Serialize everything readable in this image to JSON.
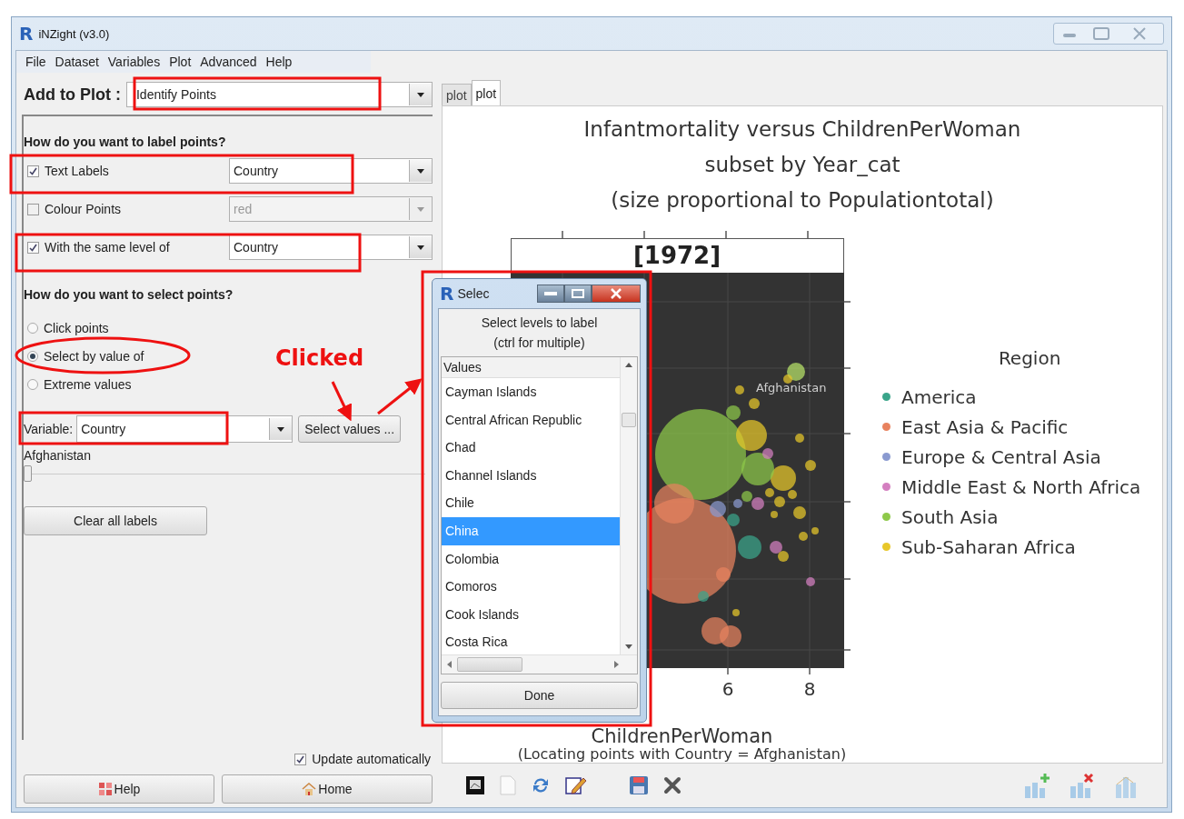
{
  "window": {
    "logo": "R",
    "title": "iNZight (v3.0)"
  },
  "menu": [
    "File",
    "Dataset",
    "Variables",
    "Plot",
    "Advanced",
    "Help"
  ],
  "add_to_plot": {
    "label": "Add to Plot :",
    "value": "Identify Points"
  },
  "label_section": {
    "heading": "How do you want to label points?",
    "rows": [
      {
        "label": "Text Labels",
        "checked": true,
        "value": "Country",
        "disabled": false
      },
      {
        "label": "Colour Points",
        "checked": false,
        "value": "red",
        "disabled": true
      },
      {
        "label": "With the same level of",
        "checked": true,
        "value": "Country",
        "disabled": false
      }
    ]
  },
  "select_section": {
    "heading": "How do you want to select points?",
    "options": [
      {
        "label": "Click points",
        "selected": false
      },
      {
        "label": "Select by value of",
        "selected": true
      },
      {
        "label": "Extreme values",
        "selected": false
      }
    ]
  },
  "variable": {
    "label": "Variable:",
    "value": "Country",
    "button": "Select values ..."
  },
  "slider": {
    "reading": "Afghanistan",
    "level": 0
  },
  "clear_button": "Clear all labels",
  "update_automatically": {
    "label": "Update automatically",
    "checked": true
  },
  "bottom_buttons": [
    "Help",
    "Home"
  ],
  "tabs": [
    {
      "label": "plot",
      "selected": false
    },
    {
      "label": "plot",
      "selected": true
    }
  ],
  "plot": {
    "title_lines": [
      "Infantmortality versus ChildrenPerWoman",
      "subset by Year_cat",
      "(size proportional to Populationtotal)"
    ],
    "panel_label": "[1972]",
    "point_label": "Afghanistan",
    "x_tick_labels": [
      "6",
      "8"
    ],
    "xlabel": "ChildrenPerWoman",
    "caption": "(Locating points with Country = Afghanistan)",
    "legend": {
      "title": "Region",
      "items": [
        {
          "label": "America",
          "color": "#3aa58a"
        },
        {
          "label": "East Asia & Pacific",
          "color": "#e8825e"
        },
        {
          "label": "Europe & Central Asia",
          "color": "#8a9ad0"
        },
        {
          "label": "Middle East & North Africa",
          "color": "#d47fc0"
        },
        {
          "label": "South Asia",
          "color": "#8ec94a"
        },
        {
          "label": "Sub-Saharan Africa",
          "color": "#e8c72a"
        }
      ]
    }
  },
  "dialog": {
    "logo": "R",
    "title": "Selec",
    "instructions": [
      "Select levels to label",
      "(ctrl for multiple)"
    ],
    "list_header": "Values",
    "items": [
      {
        "label": "Cayman Islands",
        "selected": false
      },
      {
        "label": "Central African Republic",
        "selected": false
      },
      {
        "label": "Chad",
        "selected": false
      },
      {
        "label": "Channel Islands",
        "selected": false
      },
      {
        "label": "Chile",
        "selected": false
      },
      {
        "label": "China",
        "selected": true
      },
      {
        "label": "Colombia",
        "selected": false
      },
      {
        "label": "Comoros",
        "selected": false
      },
      {
        "label": "Cook Islands",
        "selected": false
      },
      {
        "label": "Costa Rica",
        "selected": false
      }
    ],
    "done_button": "Done"
  },
  "annotation": {
    "text": "Clicked"
  }
}
